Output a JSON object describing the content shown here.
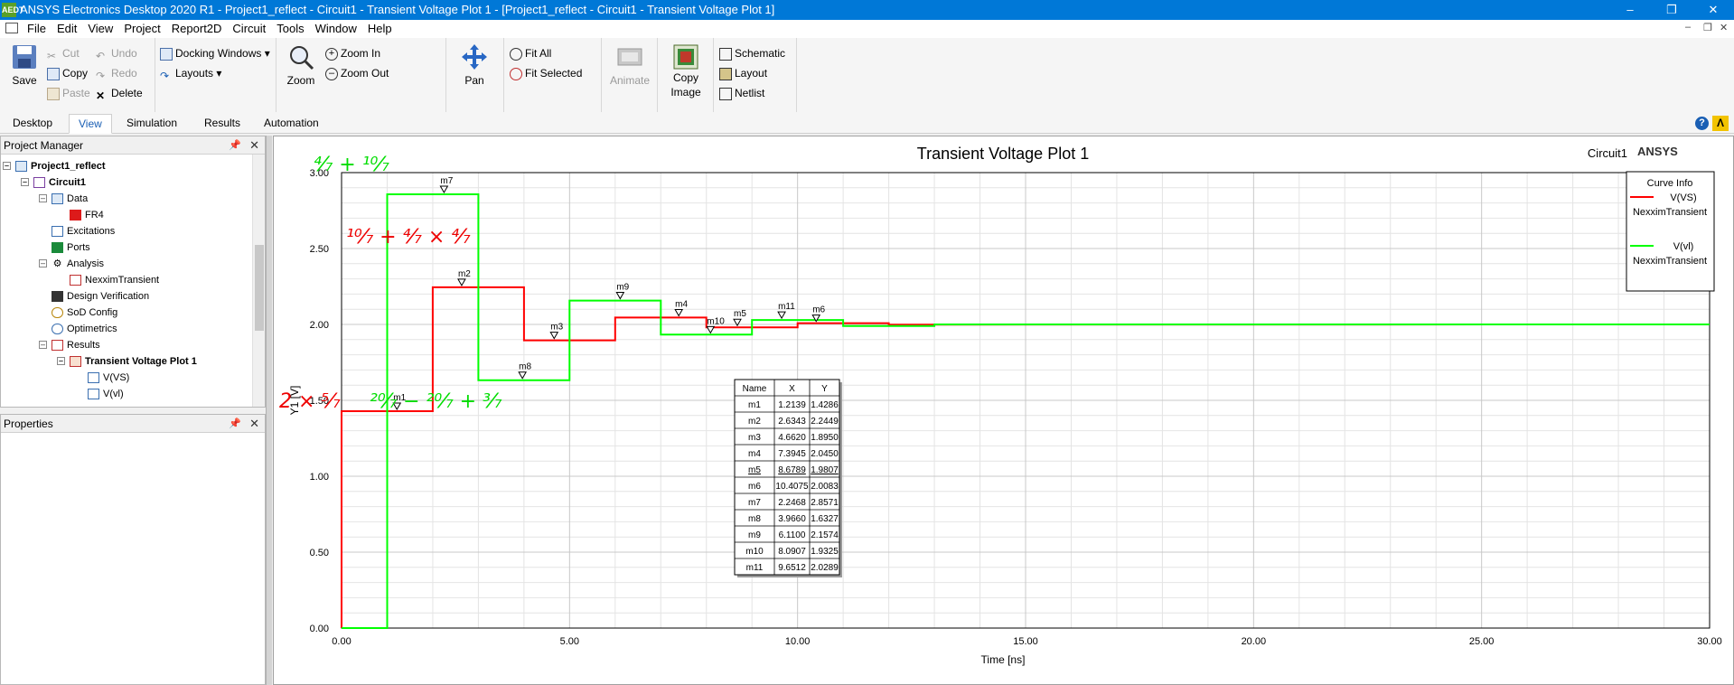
{
  "window": {
    "title": "ANSYS Electronics Desktop 2020 R1 - Project1_reflect - Circuit1 - Transient Voltage Plot 1 - [Project1_reflect - Circuit1 - Transient Voltage Plot 1]",
    "app_icon": "AEDT"
  },
  "menu": [
    "File",
    "Edit",
    "View",
    "Project",
    "Report2D",
    "Circuit",
    "Tools",
    "Window",
    "Help"
  ],
  "ribbon": {
    "save": "Save",
    "cut": "Cut",
    "copy": "Copy",
    "paste": "Paste",
    "undo": "Undo",
    "redo": "Redo",
    "delete": "Delete",
    "docking_windows": "Docking Windows",
    "layouts": "Layouts",
    "zoom": "Zoom",
    "zoom_in": "Zoom In",
    "zoom_out": "Zoom Out",
    "pan": "Pan",
    "fit_all": "Fit All",
    "fit_selected": "Fit Selected",
    "animate": "Animate",
    "copy_image_1": "Copy",
    "copy_image_2": "Image",
    "schematic": "Schematic",
    "layout": "Layout",
    "netlist": "Netlist"
  },
  "ribbon_tabs": [
    "Desktop",
    "View",
    "Simulation",
    "Results",
    "Automation"
  ],
  "project_manager": {
    "title": "Project Manager",
    "items": [
      {
        "label": "Project1_reflect",
        "bold": true
      },
      {
        "label": "Circuit1",
        "bold": true
      },
      {
        "label": "Data"
      },
      {
        "label": "FR4"
      },
      {
        "label": "Excitations"
      },
      {
        "label": "Ports"
      },
      {
        "label": "Analysis"
      },
      {
        "label": "NexximTransient"
      },
      {
        "label": "Design Verification"
      },
      {
        "label": "SoD Config"
      },
      {
        "label": "Optimetrics"
      },
      {
        "label": "Results"
      },
      {
        "label": "Transient Voltage Plot 1",
        "bold": true
      },
      {
        "label": "V(VS)"
      },
      {
        "label": "V(vl)"
      }
    ]
  },
  "properties": {
    "title": "Properties"
  },
  "plot": {
    "design_name": "Circuit1",
    "brand": "ANSYS",
    "curve_info_title": "Curve Info",
    "marker_table_headers": [
      "Name",
      "X",
      "Y"
    ],
    "markers": [
      {
        "name": "m1",
        "x": "1.2139",
        "y": "1.4286"
      },
      {
        "name": "m2",
        "x": "2.6343",
        "y": "2.2449"
      },
      {
        "name": "m3",
        "x": "4.6620",
        "y": "1.8950"
      },
      {
        "name": "m4",
        "x": "7.3945",
        "y": "2.0450"
      },
      {
        "name": "m5",
        "x": "8.6789",
        "y": "1.9807"
      },
      {
        "name": "m6",
        "x": "10.4075",
        "y": "2.0083"
      },
      {
        "name": "m7",
        "x": "2.2468",
        "y": "2.8571"
      },
      {
        "name": "m8",
        "x": "3.9660",
        "y": "1.6327"
      },
      {
        "name": "m9",
        "x": "6.1100",
        "y": "2.1574"
      },
      {
        "name": "m10",
        "x": "8.0907",
        "y": "1.9325"
      },
      {
        "name": "m11",
        "x": "9.6512",
        "y": "2.0289"
      }
    ],
    "annotations": [
      "⁴⁄₇ + ¹⁰⁄₇",
      "¹⁰⁄₇ + ⁴⁄₇ × ⁴⁄₇",
      "2 × ⁵⁄₇",
      "²⁰⁄₇ − ²⁰⁄₇ + ³⁄₇"
    ]
  },
  "chart_data": {
    "type": "line",
    "title": "Transient Voltage Plot 1",
    "xlabel": "Time [ns]",
    "ylabel": "Y1 [V]",
    "xlim": [
      0,
      30
    ],
    "ylim": [
      0,
      3
    ],
    "x_ticks": [
      "0.00",
      "5.00",
      "10.00",
      "15.00",
      "20.00",
      "25.00",
      "30.00"
    ],
    "y_ticks": [
      "0.00",
      "0.50",
      "1.00",
      "1.50",
      "2.00",
      "2.50",
      "3.00"
    ],
    "grid": true,
    "legend_placement": "top-right",
    "series": [
      {
        "name": "V(VS)",
        "sub": "NexximTransient",
        "color": "#ff0000",
        "points": [
          [
            0,
            0
          ],
          [
            0,
            1.4286
          ],
          [
            2,
            1.4286
          ],
          [
            2,
            2.2449
          ],
          [
            4,
            2.2449
          ],
          [
            4,
            1.895
          ],
          [
            6,
            1.895
          ],
          [
            6,
            2.045
          ],
          [
            8,
            2.045
          ],
          [
            8,
            1.9807
          ],
          [
            10,
            1.9807
          ],
          [
            10,
            2.0083
          ],
          [
            12,
            2.0083
          ],
          [
            12,
            1.999
          ],
          [
            30,
            2.0
          ]
        ]
      },
      {
        "name": "V(vl)",
        "sub": "NexximTransient",
        "color": "#00ff00",
        "points": [
          [
            0,
            0
          ],
          [
            1,
            0
          ],
          [
            1,
            2.8571
          ],
          [
            3,
            2.8571
          ],
          [
            3,
            1.6327
          ],
          [
            5,
            1.6327
          ],
          [
            5,
            2.1574
          ],
          [
            7,
            2.1574
          ],
          [
            7,
            1.9325
          ],
          [
            9,
            1.9325
          ],
          [
            9,
            2.0289
          ],
          [
            11,
            2.0289
          ],
          [
            11,
            1.99
          ],
          [
            13,
            1.99
          ],
          [
            13,
            2.0
          ],
          [
            30,
            2.0
          ]
        ]
      }
    ]
  }
}
